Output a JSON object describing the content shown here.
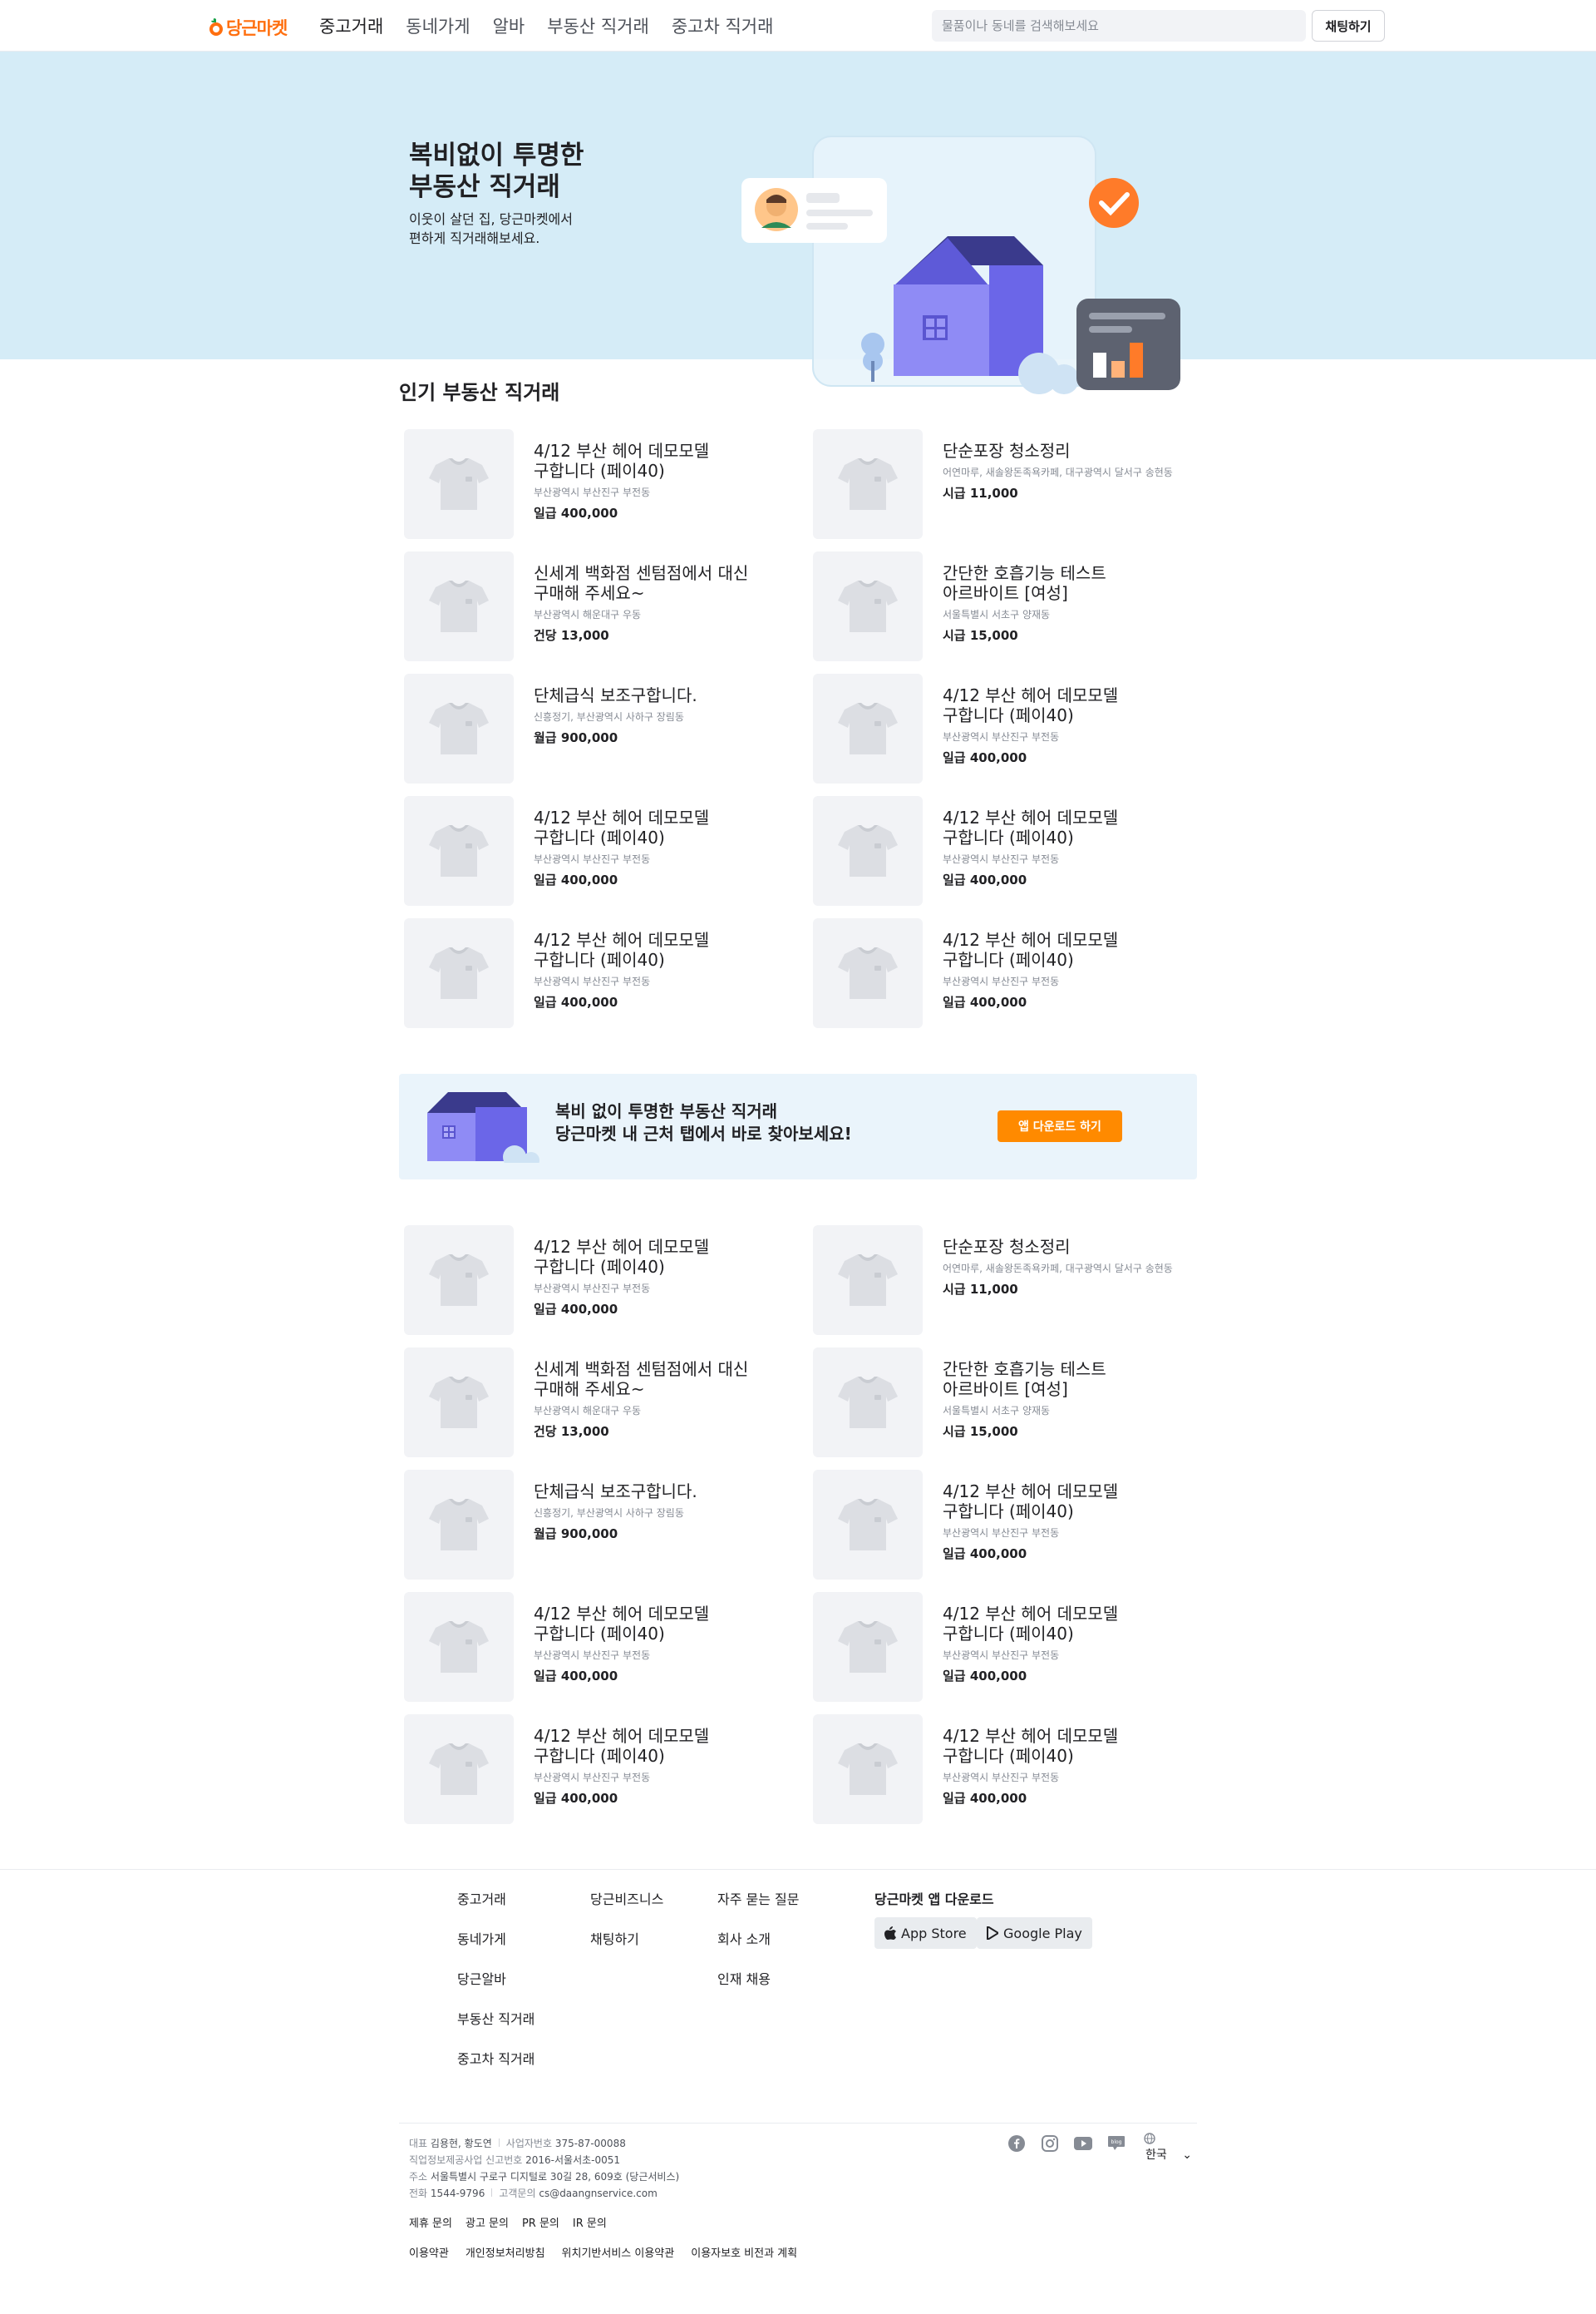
{
  "header": {
    "logo_text": "당근마켓",
    "nav": [
      "중고거래",
      "동네가게",
      "알바",
      "부동산 직거래",
      "중고차 직거래"
    ],
    "search_placeholder": "물품이나 동네를 검색해보세요",
    "chat_button": "채팅하기"
  },
  "hero": {
    "title": "복비없이 투명한\n부동산 직거래",
    "description": "이웃이 살던 집, 당근마켓에서\n편하게 직거래해보세요."
  },
  "section_title": "인기 부동산 직거래",
  "listings_top": [
    {
      "title": "4/12 부산 헤어 데모모델 구합니다 (페이40)",
      "location": "부산광역시 부산진구 부전동",
      "price": "일급 400,000"
    },
    {
      "title": "단순포장 청소정리",
      "location": "어연마루, 새솔왕돈족욕카페, 대구광역시 달서구 송현동",
      "price": "시급 11,000"
    },
    {
      "title": "신세계 백화점 센텀점에서 대신 구매해 주세요~",
      "location": "부산광역시 해운대구 우동",
      "price": "건당 13,000"
    },
    {
      "title": "간단한 호흡기능 테스트 아르바이트 [여성]",
      "location": "서울특별시 서초구 양재동",
      "price": "시급 15,000"
    },
    {
      "title": "단체급식 보조구합니다.",
      "location": "신흥정기, 부산광역시 사하구 장림동",
      "price": "월급 900,000"
    },
    {
      "title": "4/12 부산 헤어 데모모델 구합니다 (페이40)",
      "location": "부산광역시 부산진구 부전동",
      "price": "일급 400,000"
    },
    {
      "title": "4/12 부산 헤어 데모모델 구합니다 (페이40)",
      "location": "부산광역시 부산진구 부전동",
      "price": "일급 400,000"
    },
    {
      "title": "4/12 부산 헤어 데모모델 구합니다 (페이40)",
      "location": "부산광역시 부산진구 부전동",
      "price": "일급 400,000"
    },
    {
      "title": "4/12 부산 헤어 데모모델 구합니다 (페이40)",
      "location": "부산광역시 부산진구 부전동",
      "price": "일급 400,000"
    },
    {
      "title": "4/12 부산 헤어 데모모델 구합니다 (페이40)",
      "location": "부산광역시 부산진구 부전동",
      "price": "일급 400,000"
    }
  ],
  "banner": {
    "text": "복비 없이 투명한 부동산 직거래\n당근마켓 내 근처 탭에서 바로 찾아보세요!",
    "button": "앱 다운로드 하기"
  },
  "listings_bottom": [
    {
      "title": "4/12 부산 헤어 데모모델 구합니다 (페이40)",
      "location": "부산광역시 부산진구 부전동",
      "price": "일급 400,000"
    },
    {
      "title": "단순포장 청소정리",
      "location": "어연마루, 새솔왕돈족욕카페, 대구광역시 달서구 송현동",
      "price": "시급 11,000"
    },
    {
      "title": "신세계 백화점 센텀점에서 대신 구매해 주세요~",
      "location": "부산광역시 해운대구 우동",
      "price": "건당 13,000"
    },
    {
      "title": "간단한 호흡기능 테스트 아르바이트 [여성]",
      "location": "서울특별시 서초구 양재동",
      "price": "시급 15,000"
    },
    {
      "title": "단체급식 보조구합니다.",
      "location": "신흥정기, 부산광역시 사하구 장림동",
      "price": "월급 900,000"
    },
    {
      "title": "4/12 부산 헤어 데모모델 구합니다 (페이40)",
      "location": "부산광역시 부산진구 부전동",
      "price": "일급 400,000"
    },
    {
      "title": "4/12 부산 헤어 데모모델 구합니다 (페이40)",
      "location": "부산광역시 부산진구 부전동",
      "price": "일급 400,000"
    },
    {
      "title": "4/12 부산 헤어 데모모델 구합니다 (페이40)",
      "location": "부산광역시 부산진구 부전동",
      "price": "일급 400,000"
    },
    {
      "title": "4/12 부산 헤어 데모모델 구합니다 (페이40)",
      "location": "부산광역시 부산진구 부전동",
      "price": "일급 400,000"
    },
    {
      "title": "4/12 부산 헤어 데모모델 구합니다 (페이40)",
      "location": "부산광역시 부산진구 부전동",
      "price": "일급 400,000"
    }
  ],
  "footer": {
    "col1": [
      "중고거래",
      "동네가게",
      "당근알바",
      "부동산 직거래",
      "중고차 직거래"
    ],
    "col2": [
      "당근비즈니스",
      "채팅하기"
    ],
    "col3": [
      "자주 묻는 질문",
      "회사 소개",
      "인재 채용"
    ],
    "download_title": "당근마켓 앱 다운로드",
    "app_store": "App Store",
    "google_play": "Google Play",
    "corp": {
      "rep_label": "대표",
      "rep": "김용현, 황도연",
      "biz_label": "사업자번호",
      "biz": "375-87-00088",
      "telecom_label": "직업정보제공사업 신고번호",
      "telecom": "2016-서울서초-0051",
      "addr_label": "주소",
      "addr": "서울특별시 구로구 디지털로 30길 28, 609호 (당근서비스)",
      "phone_label": "전화",
      "phone": "1544-9796",
      "cs_label": "고객문의",
      "cs": "cs@daangnservice.com"
    },
    "links1": [
      "제휴 문의",
      "광고 문의",
      "PR 문의",
      "IR 문의"
    ],
    "links2": [
      "이용약관",
      "개인정보처리방침",
      "위치기반서비스 이용약관",
      "이용자보호 비전과 계획"
    ],
    "social_icons": [
      "facebook-icon",
      "instagram-icon",
      "youtube-icon",
      "blog-icon"
    ],
    "language": "한국"
  },
  "colors": {
    "brand": "#ff6f0f",
    "hero_bg": "#d5ecf7",
    "banner_bg": "#eaf4fb",
    "banner_button": "#ff8a00"
  }
}
